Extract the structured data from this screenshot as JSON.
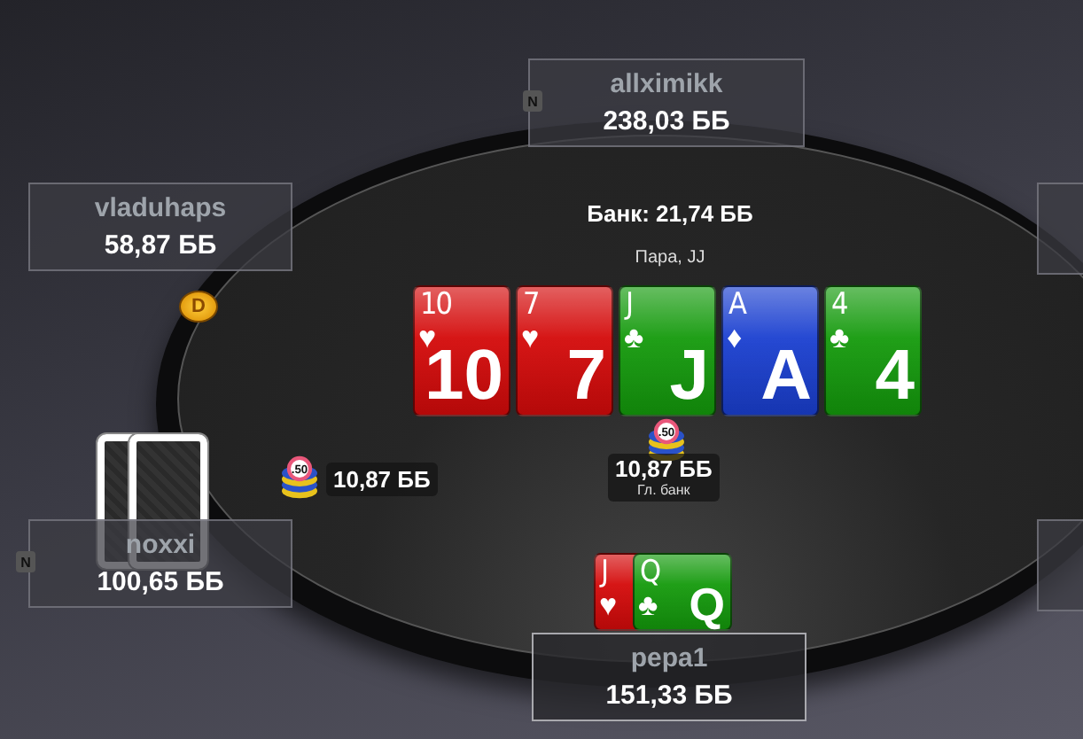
{
  "seats": [
    {
      "name": "allximikk",
      "stack": "238,03 ББ",
      "note": "N"
    },
    {
      "name": "vladuhaps",
      "stack": "58,87 ББ"
    },
    {
      "name": "noxxi",
      "stack": "100,65 ББ",
      "note": "N",
      "cards_face_down": true
    },
    {
      "name": "pepa1",
      "stack": "151,33 ББ",
      "hero": true
    }
  ],
  "dealer_button": {
    "label": "D"
  },
  "pot": {
    "label": "Банк: 21,74 ББ",
    "hand": "Пара, JJ"
  },
  "board": [
    {
      "corner_rank": "10",
      "suit": "♥",
      "big_rank": "10",
      "color": "#d40a0a"
    },
    {
      "corner_rank": "7",
      "suit": "♥",
      "big_rank": "7",
      "color": "#d40a0a"
    },
    {
      "corner_rank": "J",
      "suit": "♣",
      "big_rank": "J",
      "color": "#149a0c"
    },
    {
      "corner_rank": "A",
      "suit": "♦",
      "big_rank": "A",
      "color": "#1a3fd0"
    },
    {
      "corner_rank": "4",
      "suit": "♣",
      "big_rank": "4",
      "color": "#149a0c"
    }
  ],
  "hero_cards": [
    {
      "corner_rank": "J",
      "suit": "♥",
      "color": "#d40a0a"
    },
    {
      "corner_rank": "Q",
      "suit": "♣",
      "big_rank": "Q",
      "color": "#149a0c"
    }
  ],
  "bet": {
    "chip": ".50",
    "amount": "10,87 ББ"
  },
  "main_pot": {
    "chip": ".50",
    "amount": "10,87 ББ",
    "label": "Гл. банк"
  }
}
